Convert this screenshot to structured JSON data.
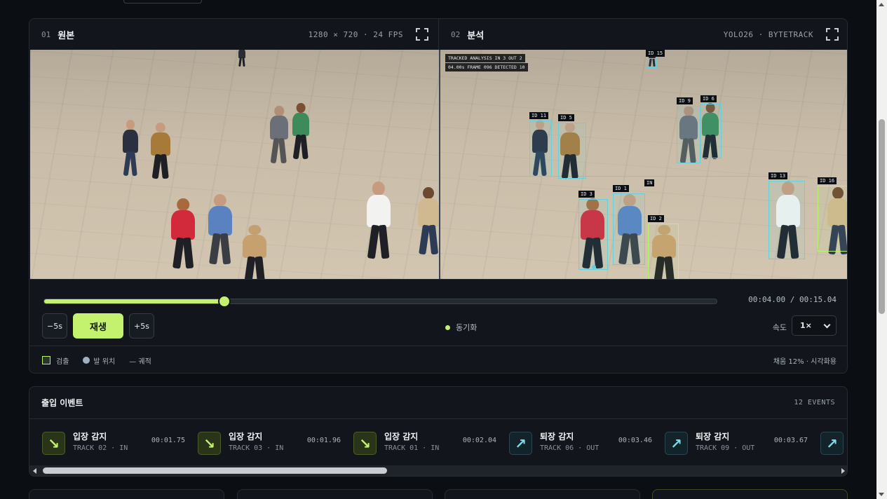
{
  "original_pane": {
    "number": "01",
    "title": "원본",
    "meta": "1280 × 720 · 24 FPS"
  },
  "analysis_pane": {
    "number": "02",
    "title": "분석",
    "meta": "YOLO26 · BYTETRACK",
    "hud_line1": "TRACKED ANALYSIS   IN 3   OUT 2",
    "hud_line2": "04.00s   FRAME 096   DETECTED 10",
    "line_label": "IN",
    "track_labels": [
      "ID 15",
      "ID 11",
      "ID 5",
      "ID 9",
      "ID 6",
      "ID 3",
      "ID 1",
      "ID 2",
      "ID 13",
      "ID 16"
    ]
  },
  "playback": {
    "progress": 0.268,
    "time": "00:04.00 / 00:15.04",
    "back_label": "−5s",
    "play_label": "재생",
    "forward_label": "+5s",
    "sync_label": "동기화",
    "speed_label": "속도",
    "speed_value": "1×"
  },
  "legend": {
    "detect": "검출",
    "foot": "발 위치",
    "trail": "— 궤적",
    "fill_note": "채움 12% · 시각화용"
  },
  "events": {
    "title": "출입 이벤트",
    "count": "12 EVENTS",
    "items": [
      {
        "title": "입장 감지",
        "sub": "TRACK 02 · IN",
        "time": "00:01.75",
        "dir": "in",
        "icon": "↘"
      },
      {
        "title": "입장 감지",
        "sub": "TRACK 03 · IN",
        "time": "00:01.96",
        "dir": "in",
        "icon": "↘"
      },
      {
        "title": "입장 감지",
        "sub": "TRACK 01 · IN",
        "time": "00:02.04",
        "dir": "in",
        "icon": "↘"
      },
      {
        "title": "퇴장 감지",
        "sub": "TRACK 06 · OUT",
        "time": "00:03.46",
        "dir": "out",
        "icon": "↗"
      },
      {
        "title": "퇴장 감지",
        "sub": "TRACK 09 · OUT",
        "time": "00:03.67",
        "dir": "out",
        "icon": "↗"
      },
      {
        "title": "",
        "sub": "",
        "time": "",
        "dir": "out",
        "icon": "↗"
      }
    ]
  },
  "colors": {
    "accent": "#c4f26e",
    "track": "#5fd3e0",
    "panel": "#12161c",
    "background": "#0b0e12"
  }
}
